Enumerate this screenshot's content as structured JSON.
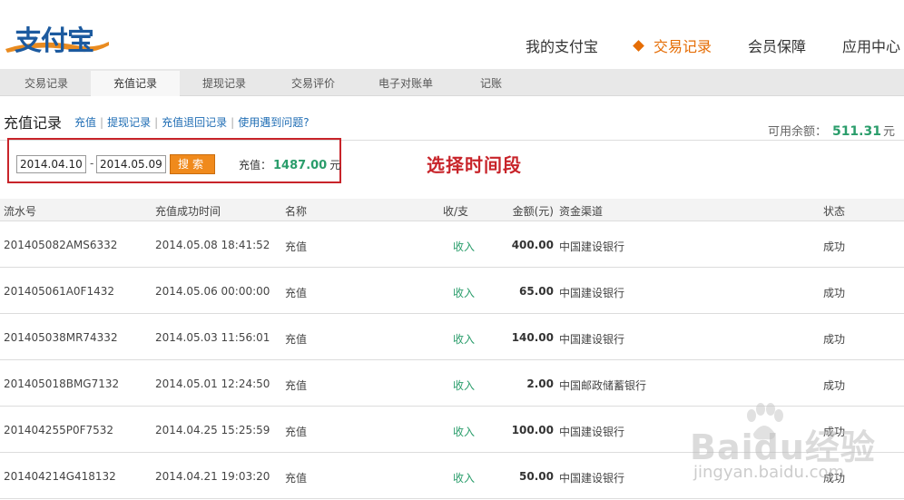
{
  "logo": {
    "text": "支付宝"
  },
  "main_nav": [
    {
      "label": "我的支付宝",
      "active": false
    },
    {
      "label": "交易记录",
      "active": true
    },
    {
      "label": "会员保障",
      "active": false
    },
    {
      "label": "应用中心",
      "active": false
    }
  ],
  "subnav": [
    {
      "label": "交易记录",
      "active": false
    },
    {
      "label": "充值记录",
      "active": true
    },
    {
      "label": "提现记录",
      "active": false
    },
    {
      "label": "交易评价",
      "active": false
    },
    {
      "label": "电子对账单",
      "active": false
    },
    {
      "label": "记账",
      "active": false
    }
  ],
  "page": {
    "title": "充值记录",
    "links": [
      "充值",
      "提现记录",
      "充值退回记录",
      "使用遇到问题?"
    ],
    "balance_label": "可用余额：",
    "balance_value": "511.31",
    "balance_unit": "元"
  },
  "filter": {
    "start_date": "2014.04.10",
    "date_separator": "-",
    "end_date": "2014.05.09",
    "search_label": "搜索",
    "recharge_label": "充值：",
    "recharge_total": "1487.00",
    "recharge_unit": "元",
    "annotation": "选择时间段"
  },
  "table": {
    "headers": {
      "serial": "流水号",
      "time": "充值成功时间",
      "name": "名称",
      "direction": "收/支",
      "amount": "金额(元)",
      "channel": "资金渠道",
      "status": "状态"
    },
    "rows": [
      {
        "serial": "201405082AMS6332",
        "time": "2014.05.08 18:41:52",
        "name": "充值",
        "direction": "收入",
        "amount": "400.00",
        "channel": "中国建设银行",
        "status": "成功"
      },
      {
        "serial": "201405061A0F1432",
        "time": "2014.05.06 00:00:00",
        "name": "充值",
        "direction": "收入",
        "amount": "65.00",
        "channel": "中国建设银行",
        "status": "成功"
      },
      {
        "serial": "201405038MR74332",
        "time": "2014.05.03 11:56:01",
        "name": "充值",
        "direction": "收入",
        "amount": "140.00",
        "channel": "中国建设银行",
        "status": "成功"
      },
      {
        "serial": "201405018BMG7132",
        "time": "2014.05.01 12:24:50",
        "name": "充值",
        "direction": "收入",
        "amount": "2.00",
        "channel": "中国邮政储蓄银行",
        "status": "成功"
      },
      {
        "serial": "201404255P0F7532",
        "time": "2014.04.25 15:25:59",
        "name": "充值",
        "direction": "收入",
        "amount": "100.00",
        "channel": "中国建设银行",
        "status": "成功"
      },
      {
        "serial": "201404214G418132",
        "time": "2014.04.21 19:03:20",
        "name": "充值",
        "direction": "收入",
        "amount": "50.00",
        "channel": "中国建设银行",
        "status": "成功"
      }
    ]
  },
  "watermark": {
    "text": "Baidu经验",
    "sub": "jingyan.baidu.com"
  },
  "colors": {
    "accent_orange": "#e56d05",
    "income_green": "#2a9d6b",
    "annotation_red": "#c8242a",
    "link_blue": "#1f6db4"
  }
}
